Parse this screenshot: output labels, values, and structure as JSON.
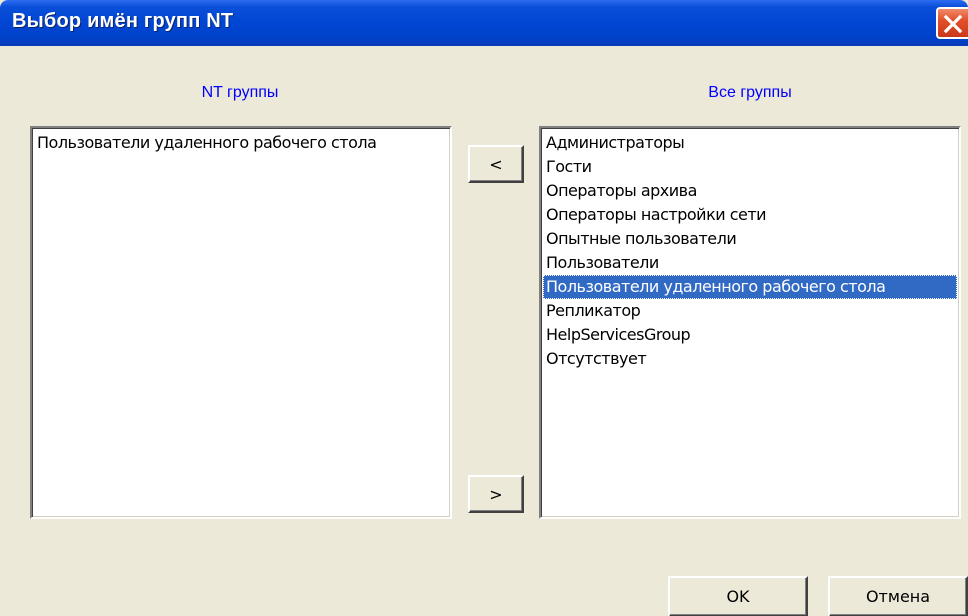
{
  "window": {
    "title": "Выбор имён групп NT"
  },
  "left_panel": {
    "label": "NT группы",
    "items": [
      "Пользователи удаленного рабочего стола"
    ]
  },
  "right_panel": {
    "label": "Все группы",
    "items": [
      "Администраторы",
      "Гости",
      "Операторы архива",
      "Операторы настройки сети",
      "Опытные пользователи",
      "Пользователи",
      "Пользователи удаленного рабочего стола",
      "Репликатор",
      "HelpServicesGroup",
      "Отсутствует"
    ],
    "selected_index": 6
  },
  "buttons": {
    "move_left": "<",
    "move_right": ">",
    "ok": "OK",
    "cancel": "Отмена"
  },
  "colors": {
    "title_bar": "#0046d4",
    "label_text": "#0000ff",
    "selection": "#316ac5",
    "close_button": "#e2502a"
  },
  "icons": {
    "close": "close-icon"
  }
}
